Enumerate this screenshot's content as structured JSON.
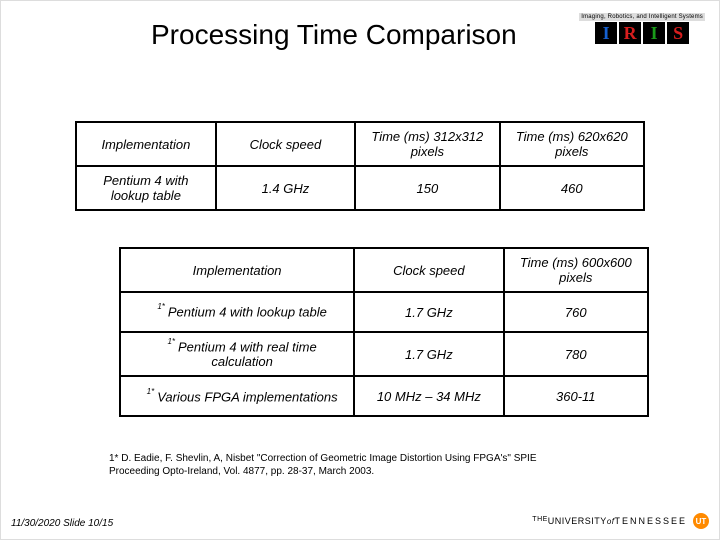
{
  "title": "Processing Time Comparison",
  "logo": {
    "tagline": "Imaging, Robotics, and Intelligent Systems",
    "letters": [
      "I",
      "R",
      "I",
      "S"
    ]
  },
  "table1": {
    "headers": [
      "Implementation",
      "Clock speed",
      "Time (ms) 312x312 pixels",
      "Time (ms) 620x620 pixels"
    ],
    "rows": [
      {
        "impl": "Pentium 4 with lookup table",
        "clock": "1.4 GHz",
        "t312": "150",
        "t620": "460"
      }
    ]
  },
  "table2": {
    "headers": [
      "Implementation",
      "Clock speed",
      "Time (ms) 600x600 pixels"
    ],
    "rows": [
      {
        "note": "1*",
        "impl": "Pentium 4 with lookup table",
        "clock": "1.7 GHz",
        "time": "760"
      },
      {
        "note": "1*",
        "impl": "Pentium 4 with real time calculation",
        "clock": "1.7 GHz",
        "time": "780"
      },
      {
        "note": "1*",
        "impl": "Various FPGA implementations",
        "clock": "10 MHz – 34 MHz",
        "time": "360-11"
      }
    ]
  },
  "citation": "1* D. Eadie, F. Shevlin, A, Nisbet \"Correction of Geometric Image Distortion Using FPGA's\" SPIE Proceeding Opto-Ireland, Vol. 4877, pp. 28-37, March 2003.",
  "footer": {
    "left": "11/30/2020   Slide 10/15",
    "univ_the": "THE",
    "univ_name": "UNIVERSITY",
    "univ_of": "of",
    "univ_tn": "TENNESSEE",
    "badge": "UT"
  },
  "chart_data": [
    {
      "type": "table",
      "title": "Processing Time Comparison",
      "columns": [
        "Implementation",
        "Clock speed",
        "Time (ms) 312x312 pixels",
        "Time (ms) 620x620 pixels"
      ],
      "rows": [
        [
          "Pentium 4 with lookup table",
          "1.4 GHz",
          150,
          460
        ]
      ]
    },
    {
      "type": "table",
      "columns": [
        "Implementation",
        "Clock speed",
        "Time (ms) 600x600 pixels"
      ],
      "rows": [
        [
          "Pentium 4 with lookup table",
          "1.7 GHz",
          760
        ],
        [
          "Pentium 4 with real time calculation",
          "1.7 GHz",
          780
        ],
        [
          "Various FPGA implementations",
          "10 MHz – 34 MHz",
          "360-11"
        ]
      ]
    }
  ]
}
